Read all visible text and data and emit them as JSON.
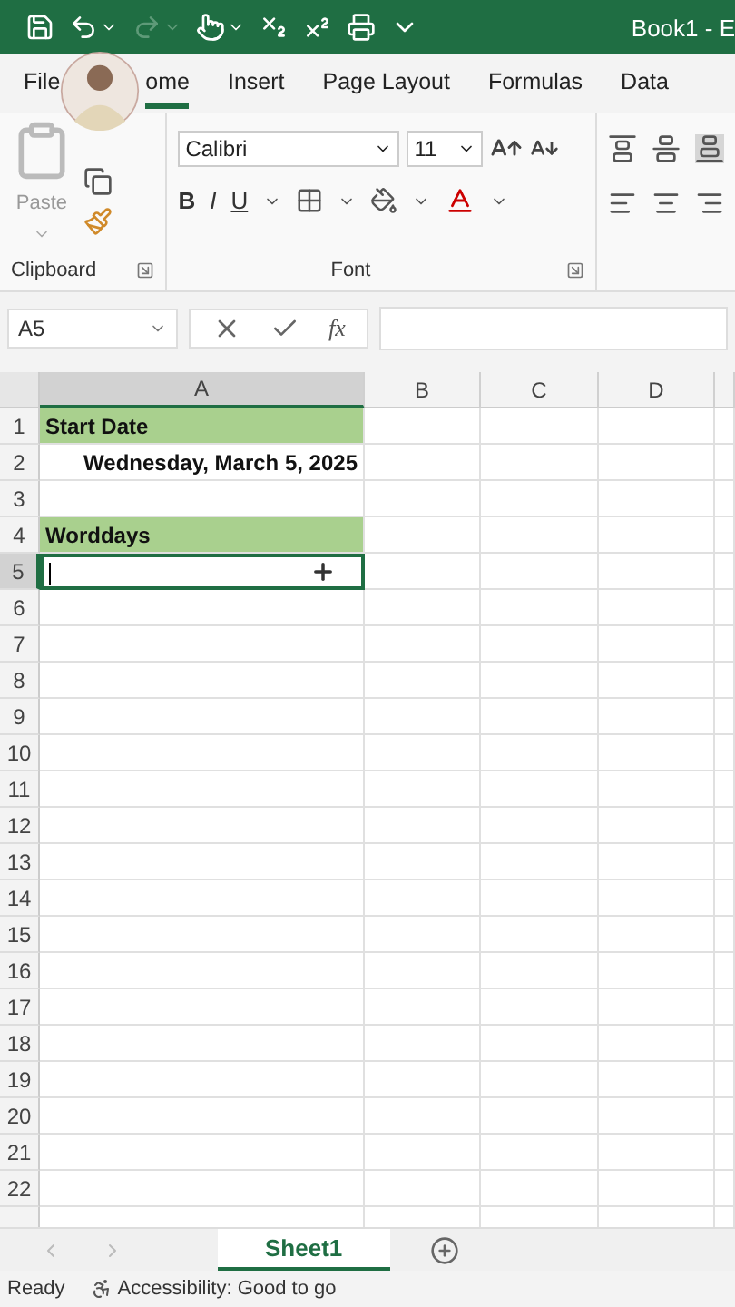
{
  "title_bar": {
    "title": "Book1 - E",
    "quick_access": [
      {
        "kind": "save",
        "disabled": false,
        "dropdown": false
      },
      {
        "kind": "undo",
        "disabled": false,
        "dropdown": true
      },
      {
        "kind": "redo",
        "disabled": true,
        "dropdown": true
      },
      {
        "kind": "touch",
        "disabled": false,
        "dropdown": true
      },
      {
        "kind": "subscript",
        "disabled": false,
        "dropdown": false
      },
      {
        "kind": "superscript",
        "disabled": false,
        "dropdown": false
      },
      {
        "kind": "print",
        "disabled": false,
        "dropdown": false
      },
      {
        "kind": "customize",
        "disabled": false,
        "dropdown": false
      }
    ]
  },
  "tabs": [
    {
      "label": "File",
      "selected": false
    },
    {
      "label": "ome",
      "selected": true
    },
    {
      "label": "Insert",
      "selected": false
    },
    {
      "label": "Page Layout",
      "selected": false
    },
    {
      "label": "Formulas",
      "selected": false
    },
    {
      "label": "Data",
      "selected": false
    }
  ],
  "ribbon": {
    "clipboard": {
      "paste_label": "Paste",
      "group_label": "Clipboard"
    },
    "font": {
      "font_name": "Calibri",
      "font_size": "11",
      "style_buttons": [
        "B",
        "I",
        "U"
      ],
      "group_label": "Font"
    }
  },
  "formula_bar": {
    "name_box": "A5",
    "function_label": "fx"
  },
  "grid": {
    "columns": [
      {
        "label": "A",
        "selected": true
      },
      {
        "label": "B",
        "selected": false
      },
      {
        "label": "C",
        "selected": false
      },
      {
        "label": "D",
        "selected": false
      }
    ],
    "rows": [
      {
        "label": "1",
        "selected": false,
        "cell_a": {
          "text": "Start Date",
          "color": "#a9d08e",
          "right_aligned": false,
          "active": false
        }
      },
      {
        "label": "2",
        "selected": false,
        "cell_a": {
          "text": "Wednesday, March 5, 2025",
          "right_aligned": true,
          "active": false
        }
      },
      {
        "label": "3",
        "selected": false
      },
      {
        "label": "4",
        "selected": false,
        "cell_a": {
          "text": "Worddays",
          "color": "#a9d08e",
          "right_aligned": false,
          "active": false
        }
      },
      {
        "label": "5",
        "selected": true,
        "cell_a": {
          "active": true
        }
      },
      {
        "label": "6",
        "selected": false
      },
      {
        "label": "7",
        "selected": false
      },
      {
        "label": "8",
        "selected": false
      },
      {
        "label": "9",
        "selected": false
      },
      {
        "label": "10",
        "selected": false
      },
      {
        "label": "11",
        "selected": false
      },
      {
        "label": "12",
        "selected": false
      },
      {
        "label": "13",
        "selected": false
      },
      {
        "label": "14",
        "selected": false
      },
      {
        "label": "15",
        "selected": false
      },
      {
        "label": "16",
        "selected": false
      },
      {
        "label": "17",
        "selected": false
      },
      {
        "label": "18",
        "selected": false
      },
      {
        "label": "19",
        "selected": false
      },
      {
        "label": "20",
        "selected": false
      },
      {
        "label": "21",
        "selected": false
      },
      {
        "label": "22",
        "selected": false
      }
    ]
  },
  "sheets": [
    {
      "label": "Sheet1",
      "selected": true
    }
  ],
  "status_bar": {
    "mode": "Ready",
    "accessibility": "Accessibility: Good to go"
  }
}
